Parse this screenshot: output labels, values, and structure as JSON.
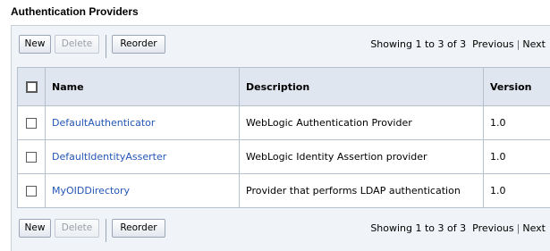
{
  "section": {
    "title": "Authentication Providers"
  },
  "toolbar": {
    "new_label": "New",
    "delete_label": "Delete",
    "reorder_label": "Reorder",
    "showing_text": "Showing 1 to 3 of 3",
    "previous_label": "Previous",
    "next_label": "Next"
  },
  "table": {
    "headers": {
      "name": "Name",
      "description": "Description",
      "version": "Version"
    },
    "rows": [
      {
        "name": "DefaultAuthenticator",
        "description": "WebLogic Authentication Provider",
        "version": "1.0"
      },
      {
        "name": "DefaultIdentityAsserter",
        "description": "WebLogic Identity Assertion provider",
        "version": "1.0"
      },
      {
        "name": "MyOIDDirectory",
        "description": "Provider that performs LDAP authentication",
        "version": "1.0"
      }
    ]
  },
  "colors": {
    "link": "#2356b5",
    "header_bg": "#dfe6f0",
    "panel_bg": "#f0f3f7"
  }
}
